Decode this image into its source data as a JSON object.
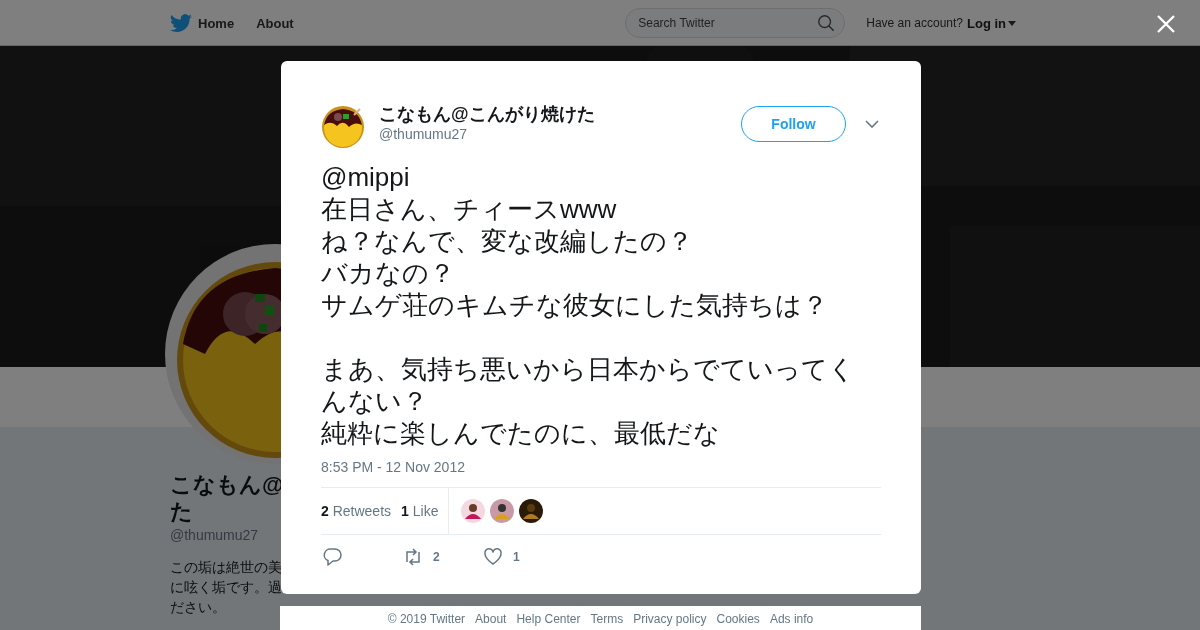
{
  "nav": {
    "links": [
      {
        "label": "Home"
      },
      {
        "label": "About"
      }
    ],
    "search": {
      "placeholder": "Search Twitter"
    },
    "account_prompt": "Have an account?",
    "login": "Log in"
  },
  "profile": {
    "name_lines": [
      "こなもん@",
      "た"
    ],
    "handle": "@thumumu27",
    "bio_lines": [
      "この垢は絶世の美",
      "に呟く垢です。過",
      "ださい。"
    ]
  },
  "tweet": {
    "name": "こなもん@こんがり焼けた",
    "handle": "@thumumu27",
    "follow": "Follow",
    "paragraphs": [
      [
        "@mippi",
        "在日さん、チィースwww",
        "ね？なんで、変な改編したの？",
        "バカなの？",
        "サムゲ荘のキムチな彼女にした気持ちは？"
      ],
      [
        "まあ、気持ち悪いから日本からでていってくんない？",
        "純粋に楽しんでたのに、最低だな"
      ]
    ],
    "timestamp": "8:53 PM - 12 Nov 2012",
    "stats": [
      {
        "count": "2",
        "label": "Retweets"
      },
      {
        "count": "1",
        "label": "Like"
      }
    ],
    "likers": [
      {
        "kind": "picture"
      },
      {
        "kind": "picture"
      },
      {
        "kind": "picture"
      }
    ],
    "actions": [
      {
        "kind": "reply"
      },
      {
        "kind": "retweet",
        "count": "2"
      },
      {
        "kind": "like",
        "count": "1"
      }
    ]
  },
  "footer": [
    "© 2019 Twitter",
    "About",
    "Help Center",
    "Terms",
    "Privacy policy",
    "Cookies",
    "Ads info"
  ]
}
